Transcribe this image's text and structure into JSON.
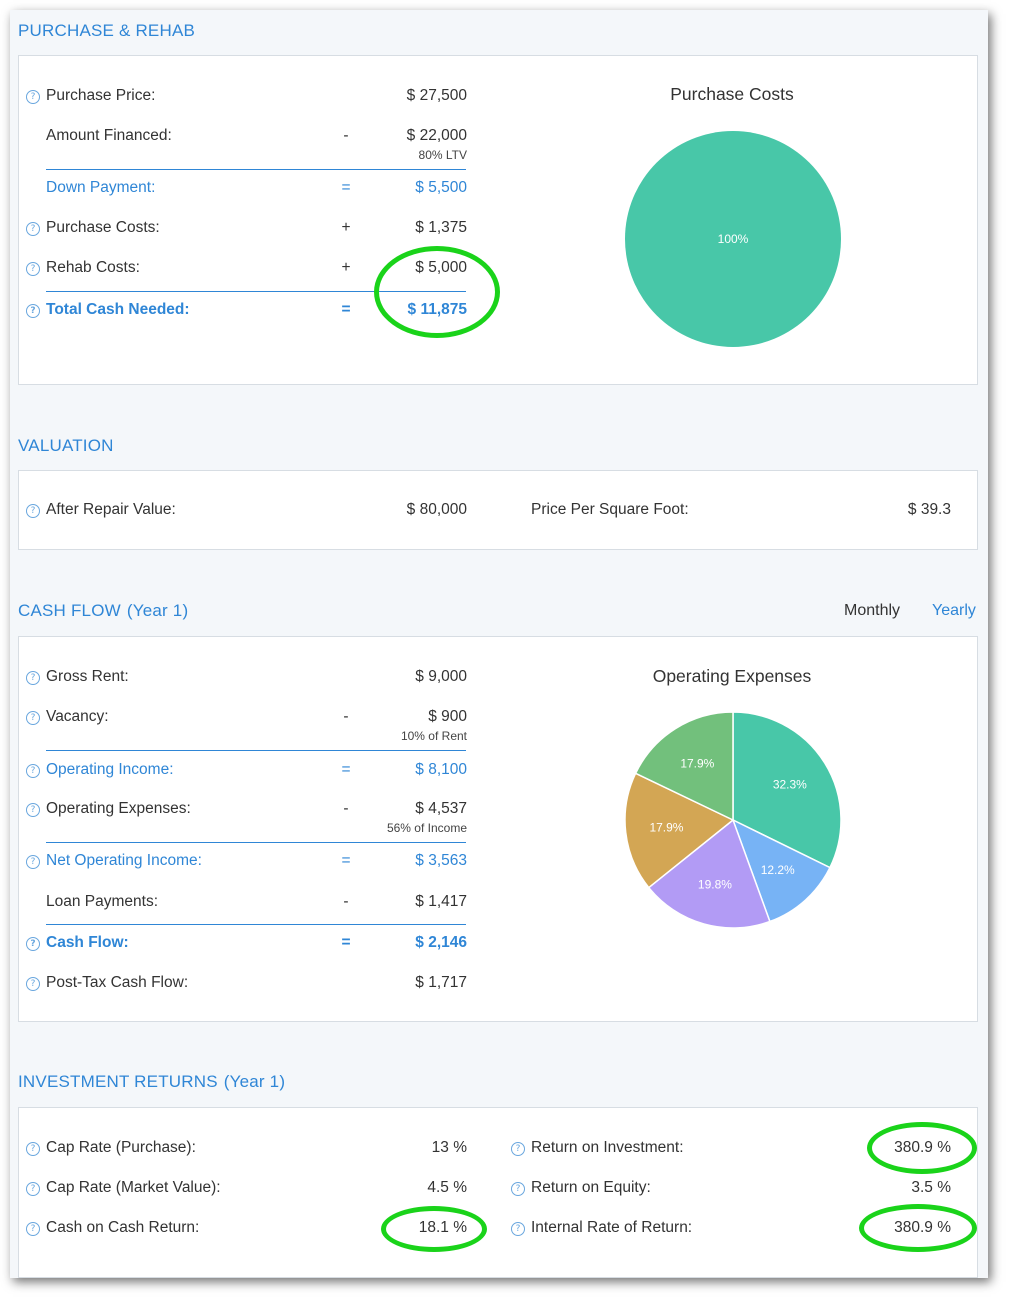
{
  "purchase": {
    "title": "PURCHASE & REHAB",
    "rows": [
      {
        "label": "Purchase Price:",
        "op": "",
        "value": "$ 27,500"
      },
      {
        "label": "Amount Financed:",
        "op": "-",
        "value": "$ 22,000",
        "note": "80% LTV"
      },
      {
        "label": "Down Payment:",
        "op": "=",
        "value": "$ 5,500"
      },
      {
        "label": "Purchase Costs:",
        "op": "+",
        "value": "$ 1,375"
      },
      {
        "label": "Rehab Costs:",
        "op": "+",
        "value": "$ 5,000"
      },
      {
        "label": "Total Cash Needed:",
        "op": "=",
        "value": "$ 11,875"
      }
    ],
    "chart_title": "Purchase Costs"
  },
  "valuation": {
    "title": "VALUATION",
    "after_repair_label": "After Repair Value:",
    "after_repair_value": "$ 80,000",
    "psf_label": "Price Per Square Foot:",
    "psf_value": "$ 39.3"
  },
  "cashflow": {
    "title": "CASH FLOW",
    "subtitle": "(Year 1)",
    "toggle_monthly": "Monthly",
    "toggle_yearly": "Yearly",
    "rows": [
      {
        "label": "Gross Rent:",
        "op": "",
        "value": "$ 9,000"
      },
      {
        "label": "Vacancy:",
        "op": "-",
        "value": "$ 900",
        "note": "10% of Rent"
      },
      {
        "label": "Operating Income:",
        "op": "=",
        "value": "$ 8,100"
      },
      {
        "label": "Operating Expenses:",
        "op": "-",
        "value": "$ 4,537",
        "note": "56% of Income"
      },
      {
        "label": "Net Operating Income:",
        "op": "=",
        "value": "$ 3,563"
      },
      {
        "label": "Loan Payments:",
        "op": "-",
        "value": "$ 1,417"
      },
      {
        "label": "Cash Flow:",
        "op": "=",
        "value": "$ 2,146"
      },
      {
        "label": "Post-Tax Cash Flow:",
        "op": "",
        "value": "$ 1,717"
      }
    ],
    "chart_title": "Operating Expenses"
  },
  "returns": {
    "title": "INVESTMENT RETURNS",
    "subtitle": "(Year 1)",
    "left": [
      {
        "label": "Cap Rate (Purchase):",
        "value": "13 %"
      },
      {
        "label": "Cap Rate (Market Value):",
        "value": "4.5 %"
      },
      {
        "label": "Cash on Cash Return:",
        "value": "18.1 %"
      }
    ],
    "right": [
      {
        "label": "Return on Investment:",
        "value": "380.9 %"
      },
      {
        "label": "Return on Equity:",
        "value": "3.5 %"
      },
      {
        "label": "Internal Rate of Return:",
        "value": "380.9 %"
      }
    ]
  },
  "colors": {
    "accent": "#2f86d6",
    "highlight": "#1ad31a"
  },
  "chart_data": [
    {
      "type": "pie",
      "title": "Purchase Costs",
      "slices": [
        {
          "label": "100%",
          "value": 100,
          "color": "#48c7a8"
        }
      ]
    },
    {
      "type": "pie",
      "title": "Operating Expenses",
      "slices": [
        {
          "label": "32.3%",
          "value": 32.3,
          "color": "#48c7a8"
        },
        {
          "label": "12.2%",
          "value": 12.2,
          "color": "#77b3f5"
        },
        {
          "label": "19.8%",
          "value": 19.8,
          "color": "#b29bf5"
        },
        {
          "label": "17.9%",
          "value": 17.9,
          "color": "#d3a654"
        },
        {
          "label": "17.9%",
          "value": 17.9,
          "color": "#72c07c"
        }
      ]
    }
  ]
}
